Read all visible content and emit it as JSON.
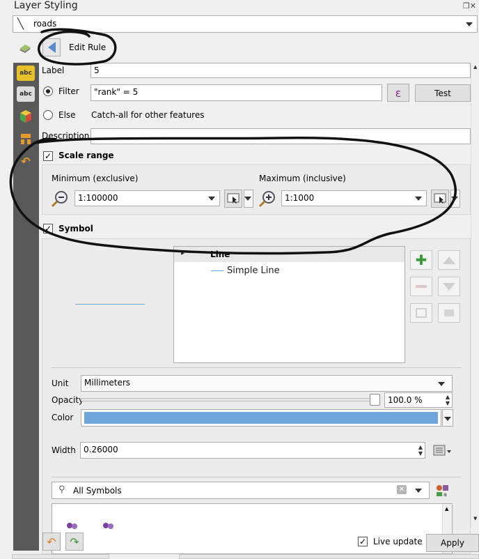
{
  "panel": {
    "title": "Layer Styling"
  },
  "layer_select": {
    "value": "roads"
  },
  "header": {
    "edit_rule_label": "Edit Rule"
  },
  "rule": {
    "label_label": "Label",
    "label_value": "5",
    "filter_label": "Filter",
    "filter_value": "\"rank\" = 5",
    "epsilon_label": "ε",
    "test_label": "Test",
    "else_label": "Else",
    "else_desc": "Catch-all for other features",
    "description_label": "Description",
    "description_value": ""
  },
  "scale_range": {
    "title": "Scale range",
    "checked": true,
    "min_label": "Minimum (exclusive)",
    "min_value": "1:100000",
    "max_label": "Maximum (inclusive)",
    "max_value": "1:1000"
  },
  "symbol": {
    "title": "Symbol",
    "checked": true,
    "tree": {
      "root": "Line",
      "child": "Simple Line"
    },
    "unit_label": "Unit",
    "unit_value": "Millimeters",
    "opacity_label": "Opacity",
    "opacity_value": "100.0 %",
    "color_label": "Color",
    "color_value": "#6fa7dc",
    "width_label": "Width",
    "width_value": "0.26000",
    "search_placeholder": "All Symbols"
  },
  "footer": {
    "live_update_label": "Live update",
    "live_update_checked": true,
    "apply_label": "Apply"
  }
}
